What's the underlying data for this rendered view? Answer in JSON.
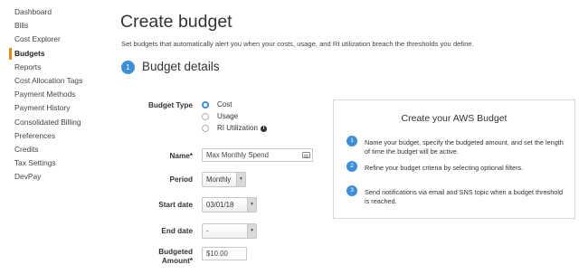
{
  "sidebar": {
    "items": [
      {
        "label": "Dashboard"
      },
      {
        "label": "Bills"
      },
      {
        "label": "Cost Explorer"
      },
      {
        "label": "Budgets",
        "active": true
      },
      {
        "label": "Reports"
      },
      {
        "label": "Cost Allocation Tags"
      },
      {
        "label": "Payment Methods"
      },
      {
        "label": "Payment History"
      },
      {
        "label": "Consolidated Billing"
      },
      {
        "label": "Preferences"
      },
      {
        "label": "Credits"
      },
      {
        "label": "Tax Settings"
      },
      {
        "label": "DevPay"
      }
    ]
  },
  "page": {
    "title": "Create budget",
    "subtitle": "Set budgets that automatically alert you when your costs, usage, and RI utilization breach the thresholds you define."
  },
  "section": {
    "number": "1",
    "title": "Budget details"
  },
  "form": {
    "budget_type": {
      "label": "Budget Type",
      "options": [
        "Cost",
        "Usage",
        "RI Utilization"
      ],
      "selected": "Cost"
    },
    "name": {
      "label": "Name*",
      "value": "Max Monthly Spend"
    },
    "period": {
      "label": "Period",
      "value": "Monthly"
    },
    "start_date": {
      "label": "Start date",
      "value": "03/01/18"
    },
    "end_date": {
      "label": "End date",
      "value": "-"
    },
    "budgeted_amount": {
      "label_line1": "Budgeted",
      "label_line2": "Amount*",
      "value": "$10.00"
    }
  },
  "info_box": {
    "title": "Create your AWS Budget",
    "steps": [
      {
        "number": "1",
        "text": "Name your budget, specify the budgeted amount, and set the length of time the budget will be active."
      },
      {
        "number": "2",
        "text": "Refine your budget criteria by selecting optional filters."
      },
      {
        "number": "3",
        "text": "Send notifications via email and SNS topic when a budget threshold is reached."
      }
    ]
  },
  "colors": {
    "accent": "#3f8ed8",
    "active_nav": "#e58a0f"
  }
}
